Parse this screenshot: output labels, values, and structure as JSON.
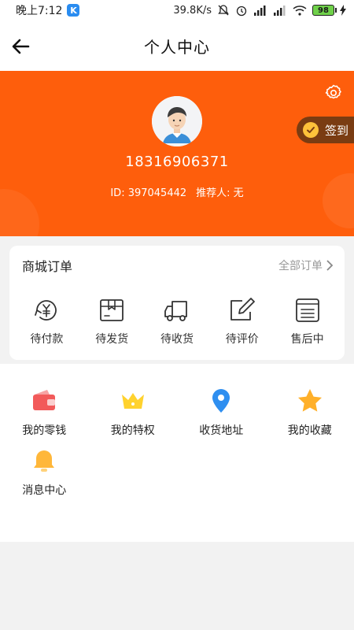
{
  "status": {
    "time": "晚上7:12",
    "app_badge": "K",
    "speed": "39.8K/s",
    "battery": "98"
  },
  "header": {
    "title": "个人中心"
  },
  "profile": {
    "phone": "18316906371",
    "id_text": "ID: 397045442",
    "referrer_text": "推荐人: 无",
    "checkin_label": "签到"
  },
  "orders": {
    "title": "商城订单",
    "all_label": "全部订单",
    "items": [
      {
        "label": "待付款",
        "icon": "pending-payment-icon"
      },
      {
        "label": "待发货",
        "icon": "pending-shipment-icon"
      },
      {
        "label": "待收货",
        "icon": "pending-receipt-icon"
      },
      {
        "label": "待评价",
        "icon": "pending-review-icon"
      },
      {
        "label": "售后中",
        "icon": "after-sales-icon"
      }
    ]
  },
  "services": {
    "items": [
      {
        "label": "我的零钱",
        "icon": "wallet-icon",
        "color": "#f25a5a"
      },
      {
        "label": "我的特权",
        "icon": "crown-icon",
        "color": "#ffd22e"
      },
      {
        "label": "收货地址",
        "icon": "location-pin-icon",
        "color": "#2f8ff0"
      },
      {
        "label": "我的收藏",
        "icon": "star-icon",
        "color": "#ffb02a"
      },
      {
        "label": "消息中心",
        "icon": "bell-icon",
        "color": "#ffb73a"
      }
    ]
  },
  "colors": {
    "brand_orange": "#fe5e0c",
    "checkin_bg": "#7a3c12"
  }
}
